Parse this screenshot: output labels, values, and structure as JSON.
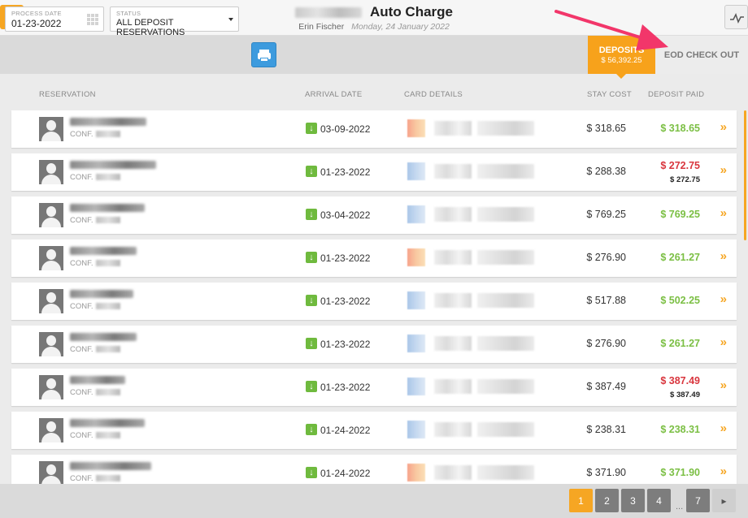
{
  "header": {
    "title": "Auto Charge",
    "user": "Erin Fischer",
    "date": "Monday, 24 January 2022"
  },
  "filters": {
    "process_date_label": "PROCESS DATE",
    "process_date_value": "01-23-2022",
    "status_label": "STATUS",
    "status_value": "ALL DEPOSIT RESERVATIONS"
  },
  "tabs": {
    "deposits_label": "DEPOSITS",
    "deposits_amount": "$ 56,392.25",
    "eod_label": "EOD CHECK OUT"
  },
  "columns": {
    "reservation": "RESERVATION",
    "arrival_date": "ARRIVAL DATE",
    "card_details": "CARD DETAILS",
    "stay_cost": "STAY COST",
    "deposit_paid": "DEPOSIT PAID"
  },
  "conf_prefix": "CONF.",
  "colors": {
    "accent": "#f6a623",
    "paid_green": "#7bbf44",
    "due_red": "#d9363e",
    "print_blue": "#3d9bde"
  },
  "rows": [
    {
      "arrival": "03-09-2022",
      "stay_cost": "$ 318.65",
      "deposit_paid": "$ 318.65",
      "deposit_secondary": "",
      "status": "paid",
      "card": "orange"
    },
    {
      "arrival": "01-23-2022",
      "stay_cost": "$ 288.38",
      "deposit_paid": "$ 272.75",
      "deposit_secondary": "$ 272.75",
      "status": "due",
      "card": "blue"
    },
    {
      "arrival": "03-04-2022",
      "stay_cost": "$ 769.25",
      "deposit_paid": "$ 769.25",
      "deposit_secondary": "",
      "status": "paid",
      "card": "blue"
    },
    {
      "arrival": "01-23-2022",
      "stay_cost": "$ 276.90",
      "deposit_paid": "$ 261.27",
      "deposit_secondary": "",
      "status": "paid",
      "card": "orange"
    },
    {
      "arrival": "01-23-2022",
      "stay_cost": "$ 517.88",
      "deposit_paid": "$ 502.25",
      "deposit_secondary": "",
      "status": "paid",
      "card": "blue"
    },
    {
      "arrival": "01-23-2022",
      "stay_cost": "$ 276.90",
      "deposit_paid": "$ 261.27",
      "deposit_secondary": "",
      "status": "paid",
      "card": "blue"
    },
    {
      "arrival": "01-23-2022",
      "stay_cost": "$ 387.49",
      "deposit_paid": "$ 387.49",
      "deposit_secondary": "$ 387.49",
      "status": "due",
      "card": "blue"
    },
    {
      "arrival": "01-24-2022",
      "stay_cost": "$ 238.31",
      "deposit_paid": "$ 238.31",
      "deposit_secondary": "",
      "status": "paid",
      "card": "blue"
    },
    {
      "arrival": "01-24-2022",
      "stay_cost": "$ 371.90",
      "deposit_paid": "$ 371.90",
      "deposit_secondary": "",
      "status": "paid",
      "card": "orange"
    }
  ],
  "pagination": {
    "pages": [
      "1",
      "2",
      "3",
      "4",
      "7"
    ],
    "current": "1",
    "ellipsis": "...",
    "next_icon": "chevron-right-icon"
  }
}
